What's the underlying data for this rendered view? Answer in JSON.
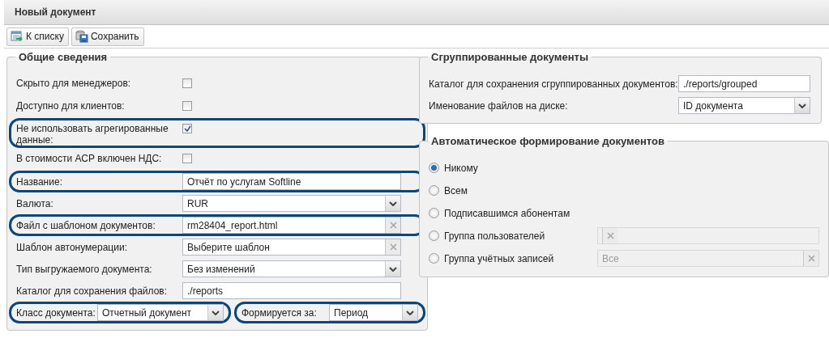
{
  "window": {
    "title": "Новый документ"
  },
  "toolbar": [
    {
      "label": "К списку"
    },
    {
      "label": "Сохранить"
    }
  ],
  "general": {
    "legend": "Общие сведения",
    "rows": [
      {
        "kind": "checkbox",
        "label": "Скрыто для менеджеров:",
        "checked": false,
        "highlighted": false
      },
      {
        "kind": "checkbox",
        "label": "Доступно для клиентов:",
        "checked": false,
        "highlighted": false
      },
      {
        "kind": "checkbox",
        "label": "Не использовать агрегированные данные:",
        "checked": true,
        "highlighted": true
      },
      {
        "kind": "checkbox",
        "label": "В стоимости АСР включен НДС:",
        "checked": false,
        "highlighted": false
      },
      {
        "kind": "text",
        "label": "Название:",
        "value": "Отчёт по услугам Softline",
        "highlighted": true
      },
      {
        "kind": "combo",
        "label": "Валюта:",
        "value": "RUR",
        "highlighted": false
      },
      {
        "kind": "clear",
        "label": "Файл с шаблоном документов:",
        "value": "rm28404_report.html",
        "highlighted": true
      },
      {
        "kind": "clear",
        "label": "Шаблон автонумерации:",
        "value": "Выберите шаблон",
        "highlighted": false
      },
      {
        "kind": "combo",
        "label": "Тип выгружаемого документа:",
        "value": "Без изменений",
        "highlighted": false
      },
      {
        "kind": "text",
        "label": "Каталог для сохранения файлов:",
        "value": "./reports",
        "highlighted": false
      },
      {
        "kind": "pair",
        "fields": [
          {
            "kind": "combo",
            "label": "Класс документа:",
            "value": "Отчетный документ",
            "highlighted": true
          },
          {
            "kind": "combo",
            "label": "Формируется за:",
            "value": "Период",
            "highlighted": true
          }
        ]
      }
    ]
  },
  "grouped": {
    "legend": "Сгруппированные документы",
    "rows": [
      {
        "kind": "text",
        "label": "Каталог для сохранения сгруппированных документов:",
        "value": "./reports/grouped",
        "highlighted": false
      },
      {
        "kind": "combo",
        "label": "Именование файлов на диске:",
        "value": "ID документа",
        "highlighted": false
      }
    ]
  },
  "auto": {
    "legend": "Автоматическое формирование документов",
    "options": [
      {
        "label": "Никому",
        "selected": true
      },
      {
        "label": "Всем",
        "selected": false
      },
      {
        "label": "Подписавшимся абонентам",
        "selected": false
      },
      {
        "label": "Группа пользователей",
        "selected": false,
        "field": {
          "disabled": true
        }
      },
      {
        "label": "Группа учётных записей",
        "selected": false,
        "field": {
          "value": "Все",
          "disabled": true
        }
      }
    ]
  }
}
